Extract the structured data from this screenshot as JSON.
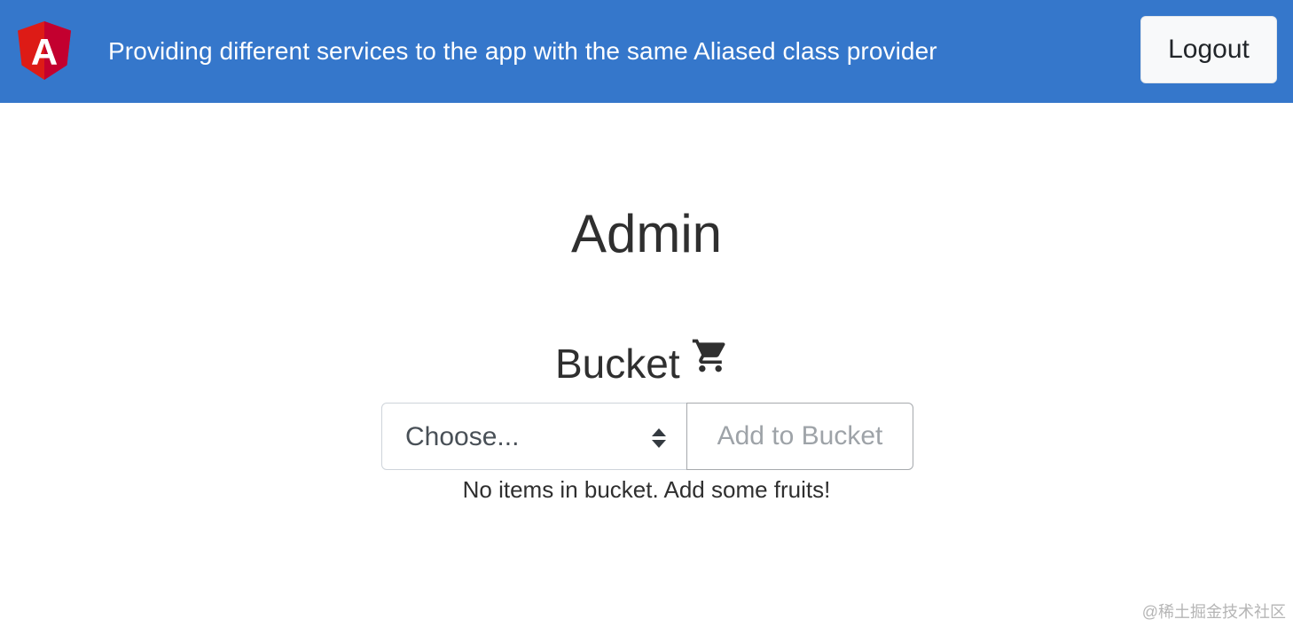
{
  "header": {
    "title": "Providing different services to the app with the same Aliased class provider",
    "logout_label": "Logout",
    "logo_letter": "A",
    "logo_icon": "angular-logo-icon",
    "background_color": "#3577cb",
    "logo_color": "#c3002f"
  },
  "main": {
    "page_title": "Admin",
    "bucket_label": "Bucket",
    "bucket_icon": "shopping-cart-icon",
    "select": {
      "selected": "Choose..."
    },
    "add_button_label": "Add to Bucket",
    "empty_message": "No items in bucket. Add some fruits!"
  },
  "watermark": {
    "text": "@稀土掘金技术社区"
  }
}
